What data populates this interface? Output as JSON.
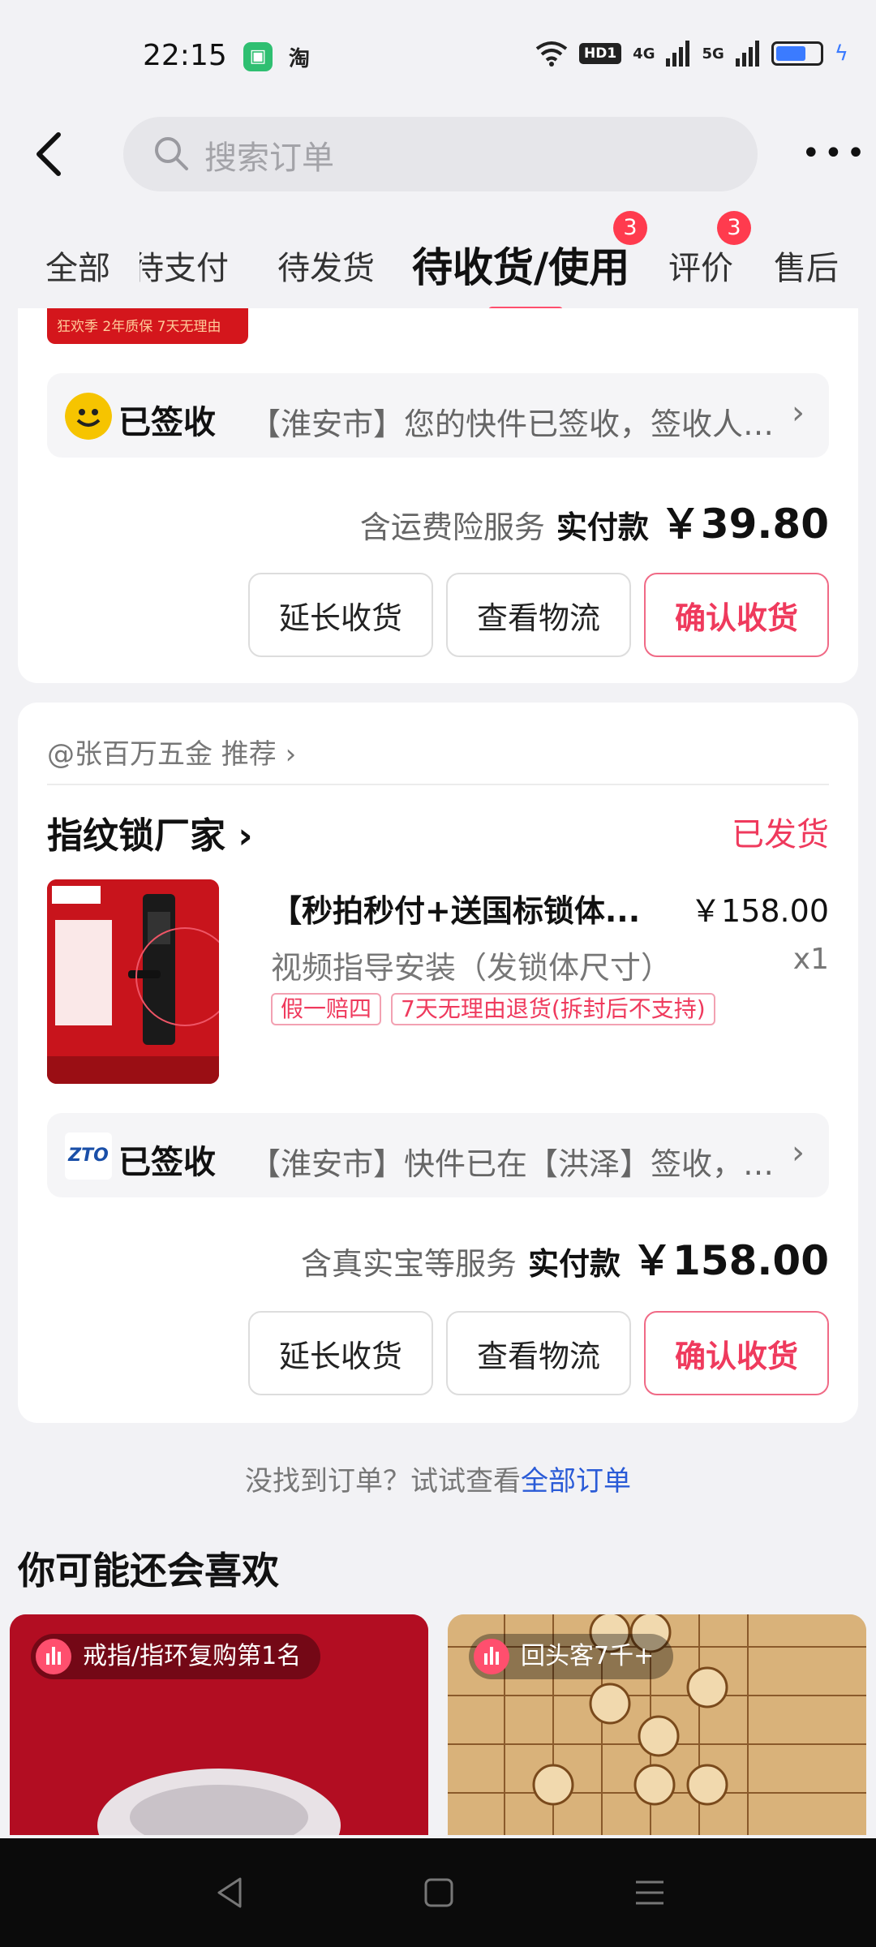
{
  "status_bar": {
    "time": "22:15",
    "app_icon_2": "淘",
    "hd_label": "HD1",
    "net1": "4G",
    "net2": "5G",
    "battery_percent": 70
  },
  "search": {
    "placeholder": "搜索订单"
  },
  "tabs": [
    {
      "label": "全部"
    },
    {
      "label": "待支付"
    },
    {
      "label": "待发货"
    },
    {
      "label": "待收货/使用",
      "badge": "3",
      "active": true
    },
    {
      "label": "评价",
      "badge": "3"
    },
    {
      "label": "售后"
    }
  ],
  "order1": {
    "thumb_banner": "狂欢季  2年质保 7天无理由",
    "logistics_status": "已签收",
    "logistics_text": "【淮安市】您的快件已签收，签收人…",
    "service_text": "含运费险服务",
    "paid_label": "实付款",
    "paid_amount": "￥39.80",
    "buttons": {
      "extend": "延长收货",
      "track": "查看物流",
      "confirm": "确认收货"
    }
  },
  "order2": {
    "recommend": "@张百万五金 推荐 ›",
    "shop_name": "指纹锁厂家 ›",
    "status": "已发货",
    "product_title": "【秒拍秒付+送国标锁体...",
    "product_price": "￥158.00",
    "product_sku": "视频指导安装（发锁体尺寸）",
    "product_qty": "x1",
    "tags": [
      "假一赔四",
      "7天无理由退货(拆封后不支持)"
    ],
    "logistics_logo": "ZTO",
    "logistics_status": "已签收",
    "logistics_text": "【淮安市】快件已在【洪泽】签收，…",
    "service_text": "含真实宝等服务",
    "paid_label": "实付款",
    "paid_amount": "￥158.00",
    "buttons": {
      "extend": "延长收货",
      "track": "查看物流",
      "confirm": "确认收货"
    }
  },
  "not_found": {
    "text": "没找到订单？试试查看",
    "link": "全部订单"
  },
  "suggest": {
    "title": "你可能还会喜欢",
    "items": [
      {
        "badge": "戒指/指环复购第1名"
      },
      {
        "badge": "回头客7千+"
      }
    ]
  },
  "colors": {
    "accent": "#ef3a5d",
    "link": "#2a5bd7",
    "background": "#f2f2f5"
  }
}
